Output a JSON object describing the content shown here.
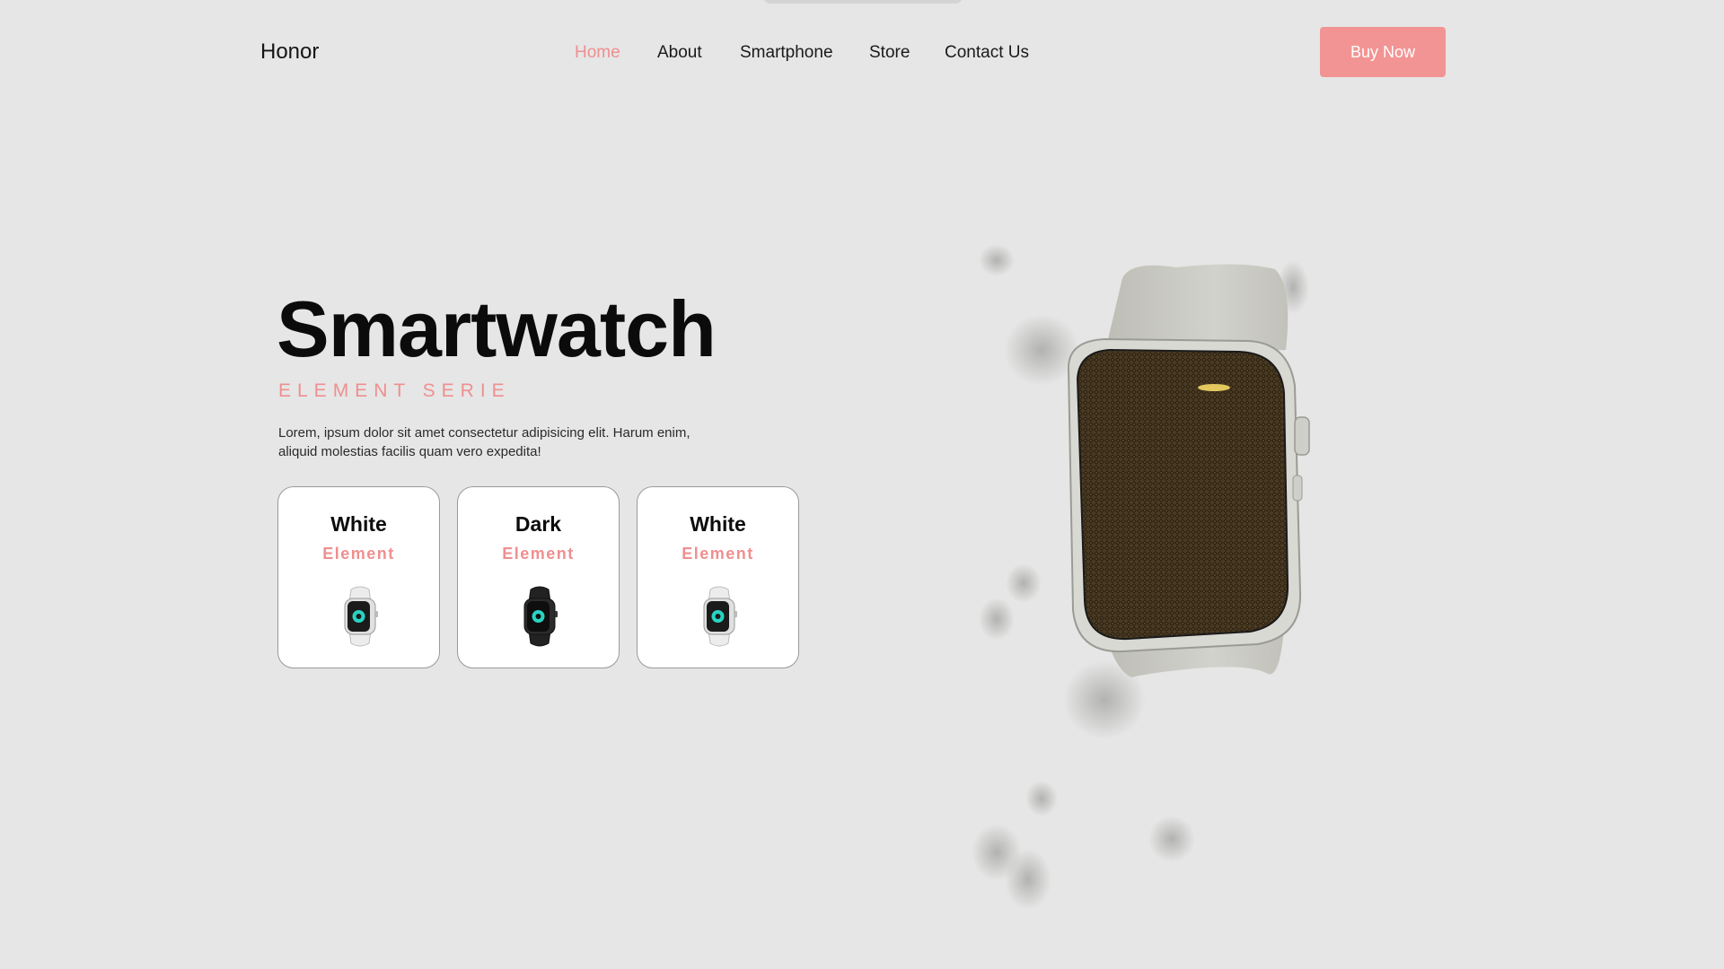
{
  "header": {
    "logo": "Honor",
    "nav": [
      {
        "label": "Home",
        "active": true
      },
      {
        "label": "About",
        "active": false
      },
      {
        "label": "Smartphone",
        "active": false
      },
      {
        "label": "Store",
        "active": false
      },
      {
        "label": "Contact Us",
        "active": false
      }
    ],
    "cta_label": "Buy Now"
  },
  "hero": {
    "title": "Smartwatch",
    "subtitle": "ELEMENT SERIE",
    "description": "Lorem, ipsum dolor sit amet consectetur adipisicing elit. Harum enim, aliquid molestias facilis quam vero expedita!"
  },
  "variants": [
    {
      "name": "White",
      "subtitle": "Element",
      "strap_color": "#ececec"
    },
    {
      "name": "Dark",
      "subtitle": "Element",
      "strap_color": "#222222"
    },
    {
      "name": "White",
      "subtitle": "Element",
      "strap_color": "#ececec"
    }
  ],
  "colors": {
    "background": "#e6e6e6",
    "accent": "#ef8f90",
    "button": "#f29494",
    "text": "#111111"
  },
  "icons": {
    "variant_thumbnail": "smartwatch-icon",
    "hero_image": "smartwatch-product-render"
  }
}
